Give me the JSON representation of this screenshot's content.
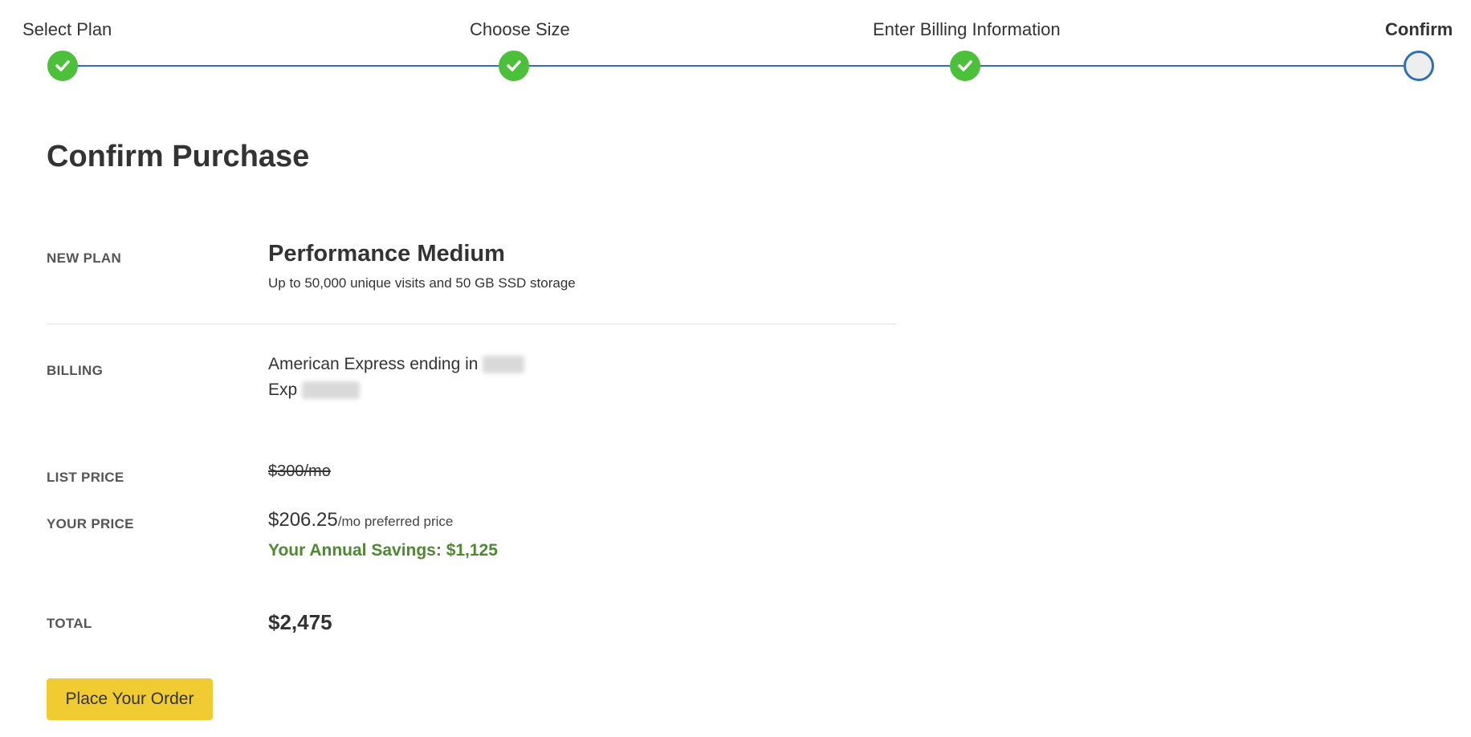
{
  "stepper": {
    "steps": [
      {
        "label": "Select Plan",
        "status": "complete"
      },
      {
        "label": "Choose Size",
        "status": "complete"
      },
      {
        "label": "Enter Billing Information",
        "status": "complete"
      },
      {
        "label": "Confirm",
        "status": "current"
      }
    ],
    "complete_icon": "checkmark-icon",
    "colors": {
      "complete": "#4cc03a",
      "line": "#2f6fb5"
    }
  },
  "page": {
    "title": "Confirm Purchase"
  },
  "plan": {
    "label": "NEW PLAN",
    "name": "Performance Medium",
    "description": "Up to 50,000 unique visits and 50 GB SSD storage"
  },
  "billing": {
    "label": "BILLING",
    "card_prefix": "American Express ending in",
    "exp_prefix": "Exp"
  },
  "pricing": {
    "list_label": "LIST PRICE",
    "list_price": "$300/mo",
    "your_label": "YOUR PRICE",
    "your_price": "$206.25",
    "your_price_suffix": "/mo preferred price",
    "savings": "Your Annual Savings: $1,125",
    "savings_color": "#4b8a2e"
  },
  "total": {
    "label": "TOTAL",
    "value": "$2,475"
  },
  "actions": {
    "order_button": "Place Your Order",
    "button_color": "#f0cc32"
  }
}
